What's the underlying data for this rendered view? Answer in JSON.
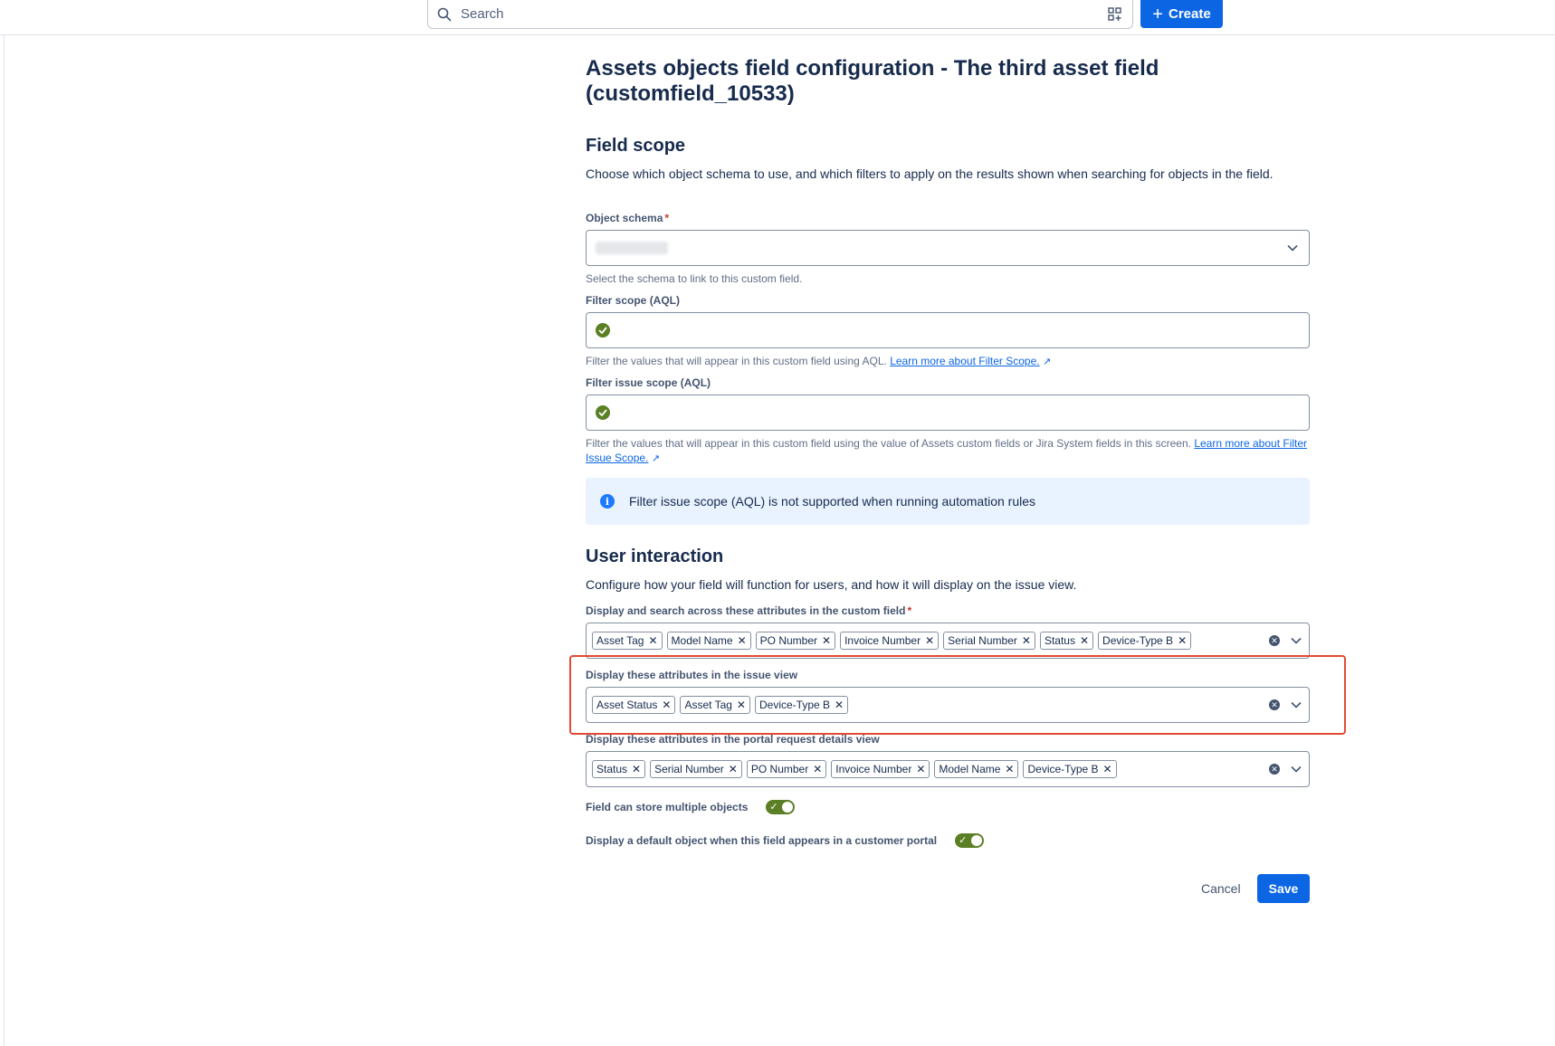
{
  "header": {
    "search_placeholder": "Search",
    "create_label": "Create"
  },
  "page": {
    "title": "Assets objects field configuration - The third asset field (customfield_10533)"
  },
  "field_scope": {
    "title": "Field scope",
    "description": "Choose which object schema to use, and which filters to apply on the results shown when searching for objects in the field.",
    "object_schema": {
      "label": "Object schema",
      "required_mark": "*",
      "helper": "Select the schema to link to this custom field."
    },
    "filter_scope": {
      "label": "Filter scope (AQL)",
      "helper": "Filter the values that will appear in this custom field using AQL.",
      "link": "Learn more about Filter Scope."
    },
    "filter_issue_scope": {
      "label": "Filter issue scope (AQL)",
      "helper": "Filter the values that will appear in this custom field using the value of Assets custom fields or Jira System fields in this screen.",
      "link": "Learn more about Filter Issue Scope."
    },
    "info": "Filter issue scope (AQL) is not supported when running automation rules"
  },
  "user_interaction": {
    "title": "User interaction",
    "description": "Configure how your field will function for users, and how it will display on the issue view.",
    "search_attributes": {
      "label": "Display and search across these attributes in the custom field",
      "required_mark": "*",
      "tags": [
        "Asset Tag",
        "Model Name",
        "PO Number",
        "Invoice Number",
        "Serial Number",
        "Status",
        "Device-Type B"
      ]
    },
    "issue_view_attributes": {
      "label": "Display these attributes in the issue view",
      "tags": [
        "Asset Status",
        "Asset Tag",
        "Device-Type B"
      ]
    },
    "portal_attributes": {
      "label": "Display these attributes in the portal request details view",
      "tags": [
        "Status",
        "Serial Number",
        "PO Number",
        "Invoice Number",
        "Model Name",
        "Device-Type B"
      ]
    },
    "multiple_objects": {
      "label": "Field can store multiple objects",
      "enabled": true
    },
    "default_object": {
      "label": "Display a default object when this field appears in a customer portal",
      "enabled": true
    }
  },
  "actions": {
    "cancel_label": "Cancel",
    "save_label": "Save"
  },
  "colors": {
    "primary": "#0c66e4",
    "success": "#5b7f24",
    "highlight": "#e34935"
  }
}
